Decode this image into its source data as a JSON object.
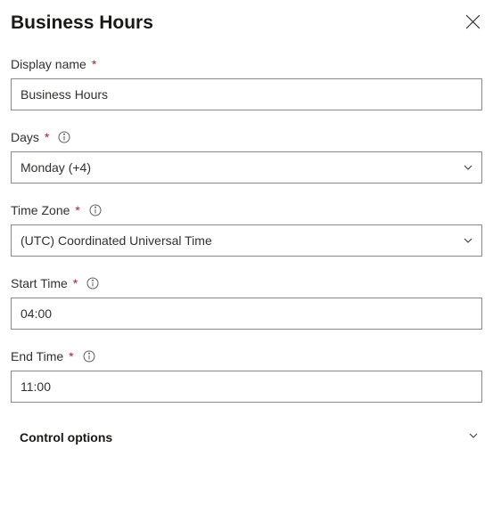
{
  "header": {
    "title": "Business Hours"
  },
  "fields": {
    "displayName": {
      "label": "Display name",
      "value": "Business Hours"
    },
    "days": {
      "label": "Days",
      "value": "Monday (+4)"
    },
    "timeZone": {
      "label": "Time Zone",
      "value": "(UTC) Coordinated Universal Time"
    },
    "startTime": {
      "label": "Start Time",
      "value": "04:00"
    },
    "endTime": {
      "label": "End Time",
      "value": "11:00"
    }
  },
  "controlOptions": {
    "label": "Control options"
  }
}
